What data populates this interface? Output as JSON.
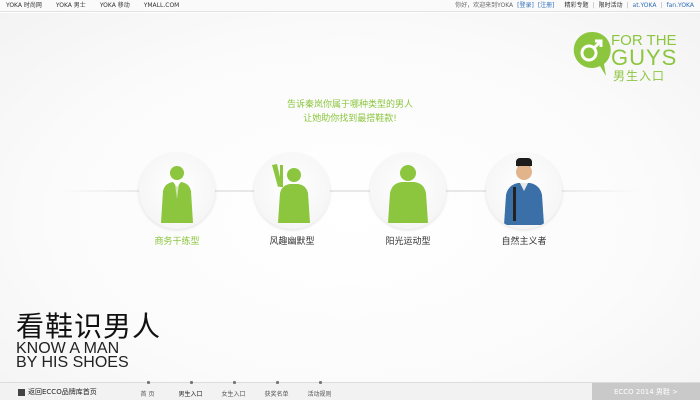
{
  "topbar": {
    "links": [
      "YOKA 时尚网",
      "YOKA 男士",
      "YOKA 移动",
      "YMALL.COM"
    ],
    "greeting": "你好，欢迎来到YOKA",
    "login": "[登录]",
    "register": "[注册]",
    "right_links": [
      "精彩专题",
      "限时活动",
      "at.YOKA",
      "fan.YOKA"
    ]
  },
  "logo": {
    "line1": "FOR THE",
    "line2": "GUYS",
    "line3": "男生入口"
  },
  "prompt": {
    "line1": "告诉秦岚你属于哪种类型的男人",
    "line2": "让她助你找到最搭鞋款!"
  },
  "types": [
    {
      "label": "商务干练型",
      "active": true
    },
    {
      "label": "风趣幽默型",
      "active": false
    },
    {
      "label": "阳光运动型",
      "active": false
    },
    {
      "label": "自然主义者",
      "active": false
    }
  ],
  "title": {
    "cn": "看鞋识男人",
    "en_line1": "KNOW A MAN",
    "en_line2": "BY HIS SHOES"
  },
  "bottom": {
    "back": "返回ECCO品牌库首页",
    "nav": [
      "首 页",
      "男生入口",
      "女生入口",
      "获奖名单",
      "活动规则"
    ],
    "active_nav": "男生入口",
    "promo": "ECCO 2014 男鞋 >"
  },
  "colors": {
    "accent": "#8cc63f",
    "silhouette": "#8cc63f"
  }
}
